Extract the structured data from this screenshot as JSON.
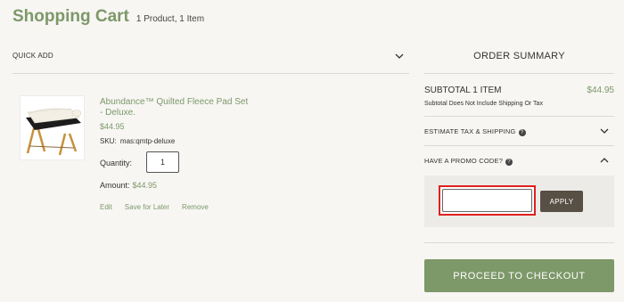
{
  "header": {
    "title": "Shopping Cart",
    "count": "1 Product, 1 Item"
  },
  "quick_add": {
    "label": "QUICK ADD"
  },
  "cart_item": {
    "name": "Abundance™ Quilted Fleece Pad Set - Deluxe.",
    "price": "$44.95",
    "sku_label": "SKU:",
    "sku": "mas:qmtp-deluxe",
    "quantity_label": "Quantity:",
    "quantity": "1",
    "amount_label": "Amount:",
    "amount": "$44.95",
    "actions": {
      "edit": "Edit",
      "save_for_later": "Save for Later",
      "remove": "Remove"
    }
  },
  "summary": {
    "title": "ORDER SUMMARY",
    "subtotal_label": "SUBTOTAL 1 ITEM",
    "subtotal_amount": "$44.95",
    "subtotal_note": "Subtotal Does Not Include Shipping Or Tax",
    "estimate_label": "ESTIMATE TAX & SHIPPING",
    "promo_label": "HAVE A PROMO CODE?",
    "promo_value": "",
    "apply_label": "APPLY",
    "checkout_label": "PROCEED TO CHECKOUT"
  },
  "colors": {
    "accent": "#7d9869",
    "apply_button": "#584f45",
    "highlight_border": "#e02020",
    "background": "#f7f6f3"
  }
}
